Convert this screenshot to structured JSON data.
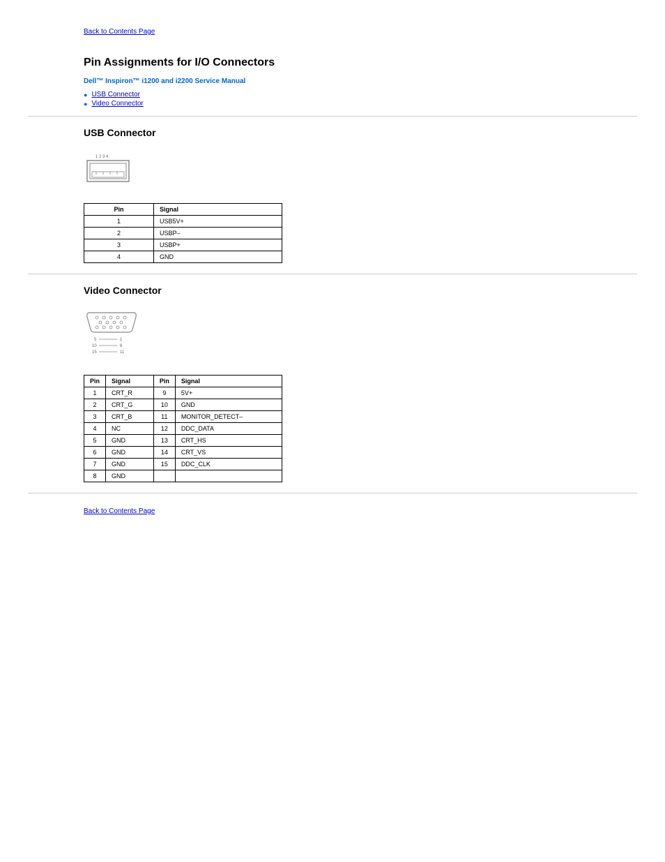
{
  "nav": {
    "back_top": "Back to Contents Page",
    "back_bottom": "Back to Contents Page"
  },
  "page": {
    "title": "Pin Assignments for I/O Connectors",
    "subtitle": "Dell™ Inspiron™ i1200 and i2200 Service Manual"
  },
  "toc": {
    "usb": "USB Connector",
    "video": "Video Connector"
  },
  "usb_section": {
    "heading": "USB Connector",
    "pin_labels": "1  2  3  4",
    "headers": {
      "pin": "Pin",
      "signal": "Signal"
    },
    "rows": [
      {
        "pin": "1",
        "signal": "USB5V+"
      },
      {
        "pin": "2",
        "signal": "USBP–"
      },
      {
        "pin": "3",
        "signal": "USBP+"
      },
      {
        "pin": "4",
        "signal": "GND"
      }
    ]
  },
  "video_section": {
    "heading": "Video Connector",
    "row_labels": {
      "r1_left": "5",
      "r1_right": "1",
      "r2_left": "10",
      "r2_right": "6",
      "r3_left": "15",
      "r3_right": "11"
    },
    "headers": {
      "pin": "Pin",
      "signal": "Signal"
    },
    "rows": [
      {
        "pin_a": "1",
        "signal_a": "CRT_R",
        "pin_b": "9",
        "signal_b": "5V+"
      },
      {
        "pin_a": "2",
        "signal_a": "CRT_G",
        "pin_b": "10",
        "signal_b": "GND"
      },
      {
        "pin_a": "3",
        "signal_a": "CRT_B",
        "pin_b": "11",
        "signal_b": "MONITOR_DETECT–"
      },
      {
        "pin_a": "4",
        "signal_a": "NC",
        "pin_b": "12",
        "signal_b": "DDC_DATA"
      },
      {
        "pin_a": "5",
        "signal_a": "GND",
        "pin_b": "13",
        "signal_b": "CRT_HS"
      },
      {
        "pin_a": "6",
        "signal_a": "GND",
        "pin_b": "14",
        "signal_b": "CRT_VS"
      },
      {
        "pin_a": "7",
        "signal_a": "GND",
        "pin_b": "15",
        "signal_b": "DDC_CLK"
      },
      {
        "pin_a": "8",
        "signal_a": "GND",
        "pin_b": "",
        "signal_b": ""
      }
    ]
  }
}
